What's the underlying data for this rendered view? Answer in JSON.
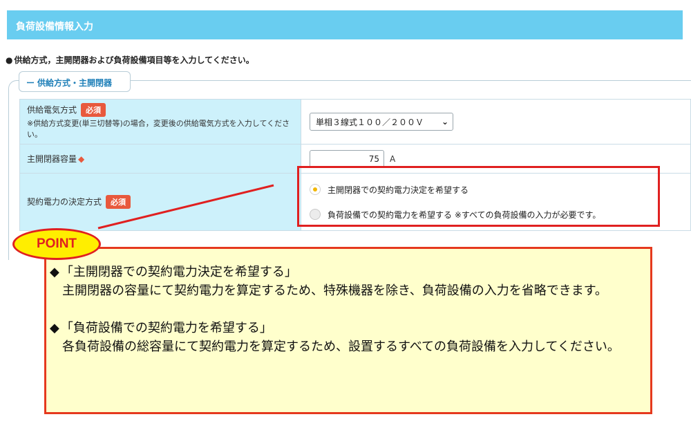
{
  "header": {
    "title": "負荷設備情報入力"
  },
  "instruction": {
    "bullet": "●",
    "text": "供給方式，主開閉器および負荷設備項目等を入力してください。"
  },
  "section": {
    "dash": "ー",
    "title": "供給方式・主開閉器"
  },
  "form": {
    "supply_method": {
      "label": "供給電気方式",
      "badge": "必須",
      "note": "※供給方式変更(単三切替等)の場合，変更後の供給電気方式を入力してください。",
      "selected": "単相３線式１００／２００Ｖ"
    },
    "breaker_capacity": {
      "label": "主開閉器容量",
      "required_mark": "◆",
      "value": "75",
      "unit": "A"
    },
    "contract_method": {
      "label": "契約電力の決定方式",
      "badge": "必須",
      "options": [
        {
          "label": "主開閉器での契約電力決定を希望する",
          "checked": true
        },
        {
          "label": "負荷設備での契約電力を希望する ※すべての負荷設備の入力が必要です。",
          "checked": false
        }
      ]
    }
  },
  "point": {
    "label": "POINT",
    "items": [
      {
        "diamond": "◆",
        "heading": "「主開閉器での契約電力決定を希望する」",
        "body": "主開閉器の容量にて契約電力を算定するため、特殊機器を除き、負荷設備の入力を省略できます。"
      },
      {
        "diamond": "◆",
        "heading": "「負荷設備での契約電力を希望する」",
        "body": "各負荷設備の総容量にて契約電力を算定するため、設置するすべての負荷設備を入力してください。"
      }
    ]
  },
  "colors": {
    "header_bg": "#69cdf0",
    "label_bg": "#cdf1fb",
    "badge_bg": "#e8593d",
    "highlight_red": "#e02020",
    "point_bg": "#ffffcc",
    "point_ellipse": "#ffee00"
  }
}
